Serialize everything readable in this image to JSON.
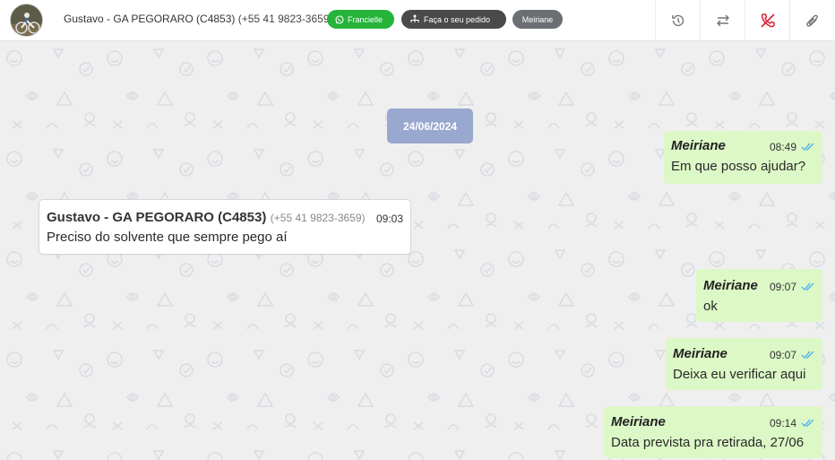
{
  "header": {
    "contact_name": "Gustavo - GA PEGORARO (C4853)",
    "contact_phone": "(+55 41 9823-3659)",
    "tags": {
      "whatsapp_agent": "Francielle",
      "order": "Faça o seu pedido",
      "assignee": "Meiriane"
    },
    "icons": [
      "history-icon",
      "transfer-icon",
      "hangup-call-icon",
      "attach-icon"
    ]
  },
  "chat": {
    "date": "24/06/2024",
    "messages": [
      {
        "direction": "out",
        "sender": "Meiriane",
        "time": "08:49",
        "text": "Em que posso ajudar?",
        "status": "read"
      },
      {
        "direction": "in",
        "sender": "Gustavo - GA PEGORARO (C4853)",
        "phone": "(+55 41 9823-3659)",
        "time": "09:03",
        "text": "Preciso do solvente que sempre pego aí"
      },
      {
        "direction": "out",
        "sender": "Meiriane",
        "time": "09:07",
        "text": "ok",
        "status": "read"
      },
      {
        "direction": "out",
        "sender": "Meiriane",
        "time": "09:07",
        "text": "Deixa eu verificar aqui",
        "status": "read"
      },
      {
        "direction": "out",
        "sender": "Meiriane",
        "time": "09:14",
        "text": "Data prevista pra retirada, 27/06",
        "status": "read"
      }
    ]
  },
  "colors": {
    "outgoing_bubble": "#dcf8c6",
    "incoming_bubble": "#ffffff",
    "date_pill": "#99a8cf",
    "whatsapp_tag": "#25b33a",
    "read_ticks": "#4fb6ec",
    "hangup_icon": "#d9213b"
  }
}
